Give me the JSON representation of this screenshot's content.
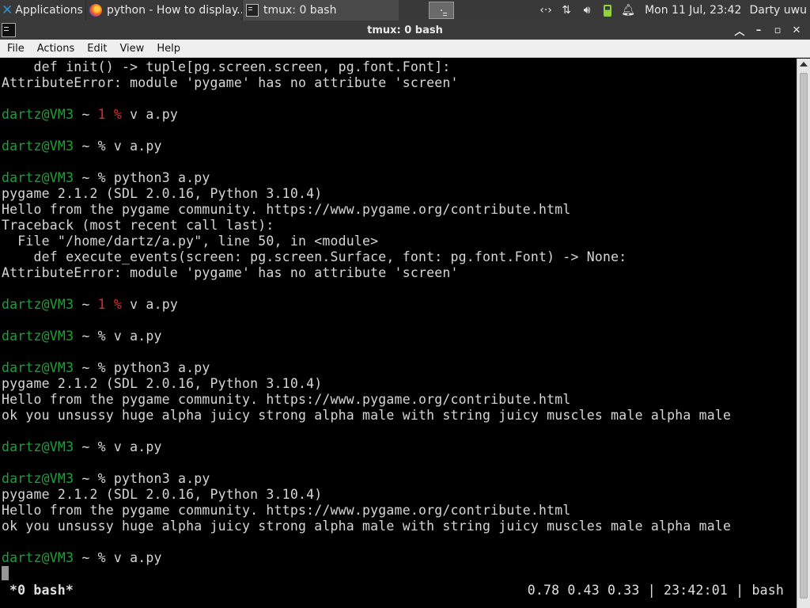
{
  "panel": {
    "applications_label": "Applications",
    "tasks": [
      {
        "label": "python - How to display..."
      },
      {
        "label": "tmux: 0 bash"
      }
    ],
    "clock": "Mon 11 Jul, 23:42",
    "user": "Darty uwu"
  },
  "window": {
    "title": "tmux: 0 bash"
  },
  "menu": {
    "file": "File",
    "actions": "Actions",
    "edit": "Edit",
    "view": "View",
    "help": "Help"
  },
  "terminal": {
    "lines": [
      {
        "text": "    def init() -> tuple[pg.screen.screen, pg.font.Font]:"
      },
      {
        "text": "AttributeError: module 'pygame' has no attribute 'screen'"
      },
      {
        "text": ""
      },
      {
        "prompt": "dartz@VM3",
        "sep": " ~ ",
        "code": "1 %",
        "cmd": " v a.py"
      },
      {
        "text": ""
      },
      {
        "prompt": "dartz@VM3",
        "sep": " ~ % ",
        "cmd": "v a.py"
      },
      {
        "text": ""
      },
      {
        "prompt": "dartz@VM3",
        "sep": " ~ % ",
        "cmd": "python3 a.py"
      },
      {
        "text": "pygame 2.1.2 (SDL 2.0.16, Python 3.10.4)"
      },
      {
        "text": "Hello from the pygame community. https://www.pygame.org/contribute.html"
      },
      {
        "text": "Traceback (most recent call last):"
      },
      {
        "text": "  File \"/home/dartz/a.py\", line 50, in <module>"
      },
      {
        "text": "    def execute_events(screen: pg.screen.Surface, font: pg.font.Font) -> None:"
      },
      {
        "text": "AttributeError: module 'pygame' has no attribute 'screen'"
      },
      {
        "text": ""
      },
      {
        "prompt": "dartz@VM3",
        "sep": " ~ ",
        "code": "1 %",
        "cmd": " v a.py"
      },
      {
        "text": ""
      },
      {
        "prompt": "dartz@VM3",
        "sep": " ~ % ",
        "cmd": "v a.py"
      },
      {
        "text": ""
      },
      {
        "prompt": "dartz@VM3",
        "sep": " ~ % ",
        "cmd": "python3 a.py"
      },
      {
        "text": "pygame 2.1.2 (SDL 2.0.16, Python 3.10.4)"
      },
      {
        "text": "Hello from the pygame community. https://www.pygame.org/contribute.html"
      },
      {
        "text": "ok you unsussy huge alpha juicy strong alpha male with string juicy muscles male alpha male"
      },
      {
        "text": ""
      },
      {
        "prompt": "dartz@VM3",
        "sep": " ~ % ",
        "cmd": "v a.py"
      },
      {
        "text": ""
      },
      {
        "prompt": "dartz@VM3",
        "sep": " ~ % ",
        "cmd": "python3 a.py"
      },
      {
        "text": "pygame 2.1.2 (SDL 2.0.16, Python 3.10.4)"
      },
      {
        "text": "Hello from the pygame community. https://www.pygame.org/contribute.html"
      },
      {
        "text": "ok you unsussy huge alpha juicy strong alpha male with string juicy muscles male alpha male"
      },
      {
        "text": ""
      },
      {
        "prompt": "dartz@VM3",
        "sep": " ~ % ",
        "cmd": "v a.py"
      },
      {
        "cursor": true
      }
    ],
    "status": {
      "window_name": "*0 bash*",
      "load": "0.78 0.43 0.33",
      "time": "23:42:01",
      "shell": "bash",
      "divider": " | "
    }
  },
  "colors": {
    "prompt": "#1f9e3a",
    "error_code": "#d32f2f",
    "terminal_bg": "#000000",
    "terminal_fg": "#d6d6d6"
  }
}
